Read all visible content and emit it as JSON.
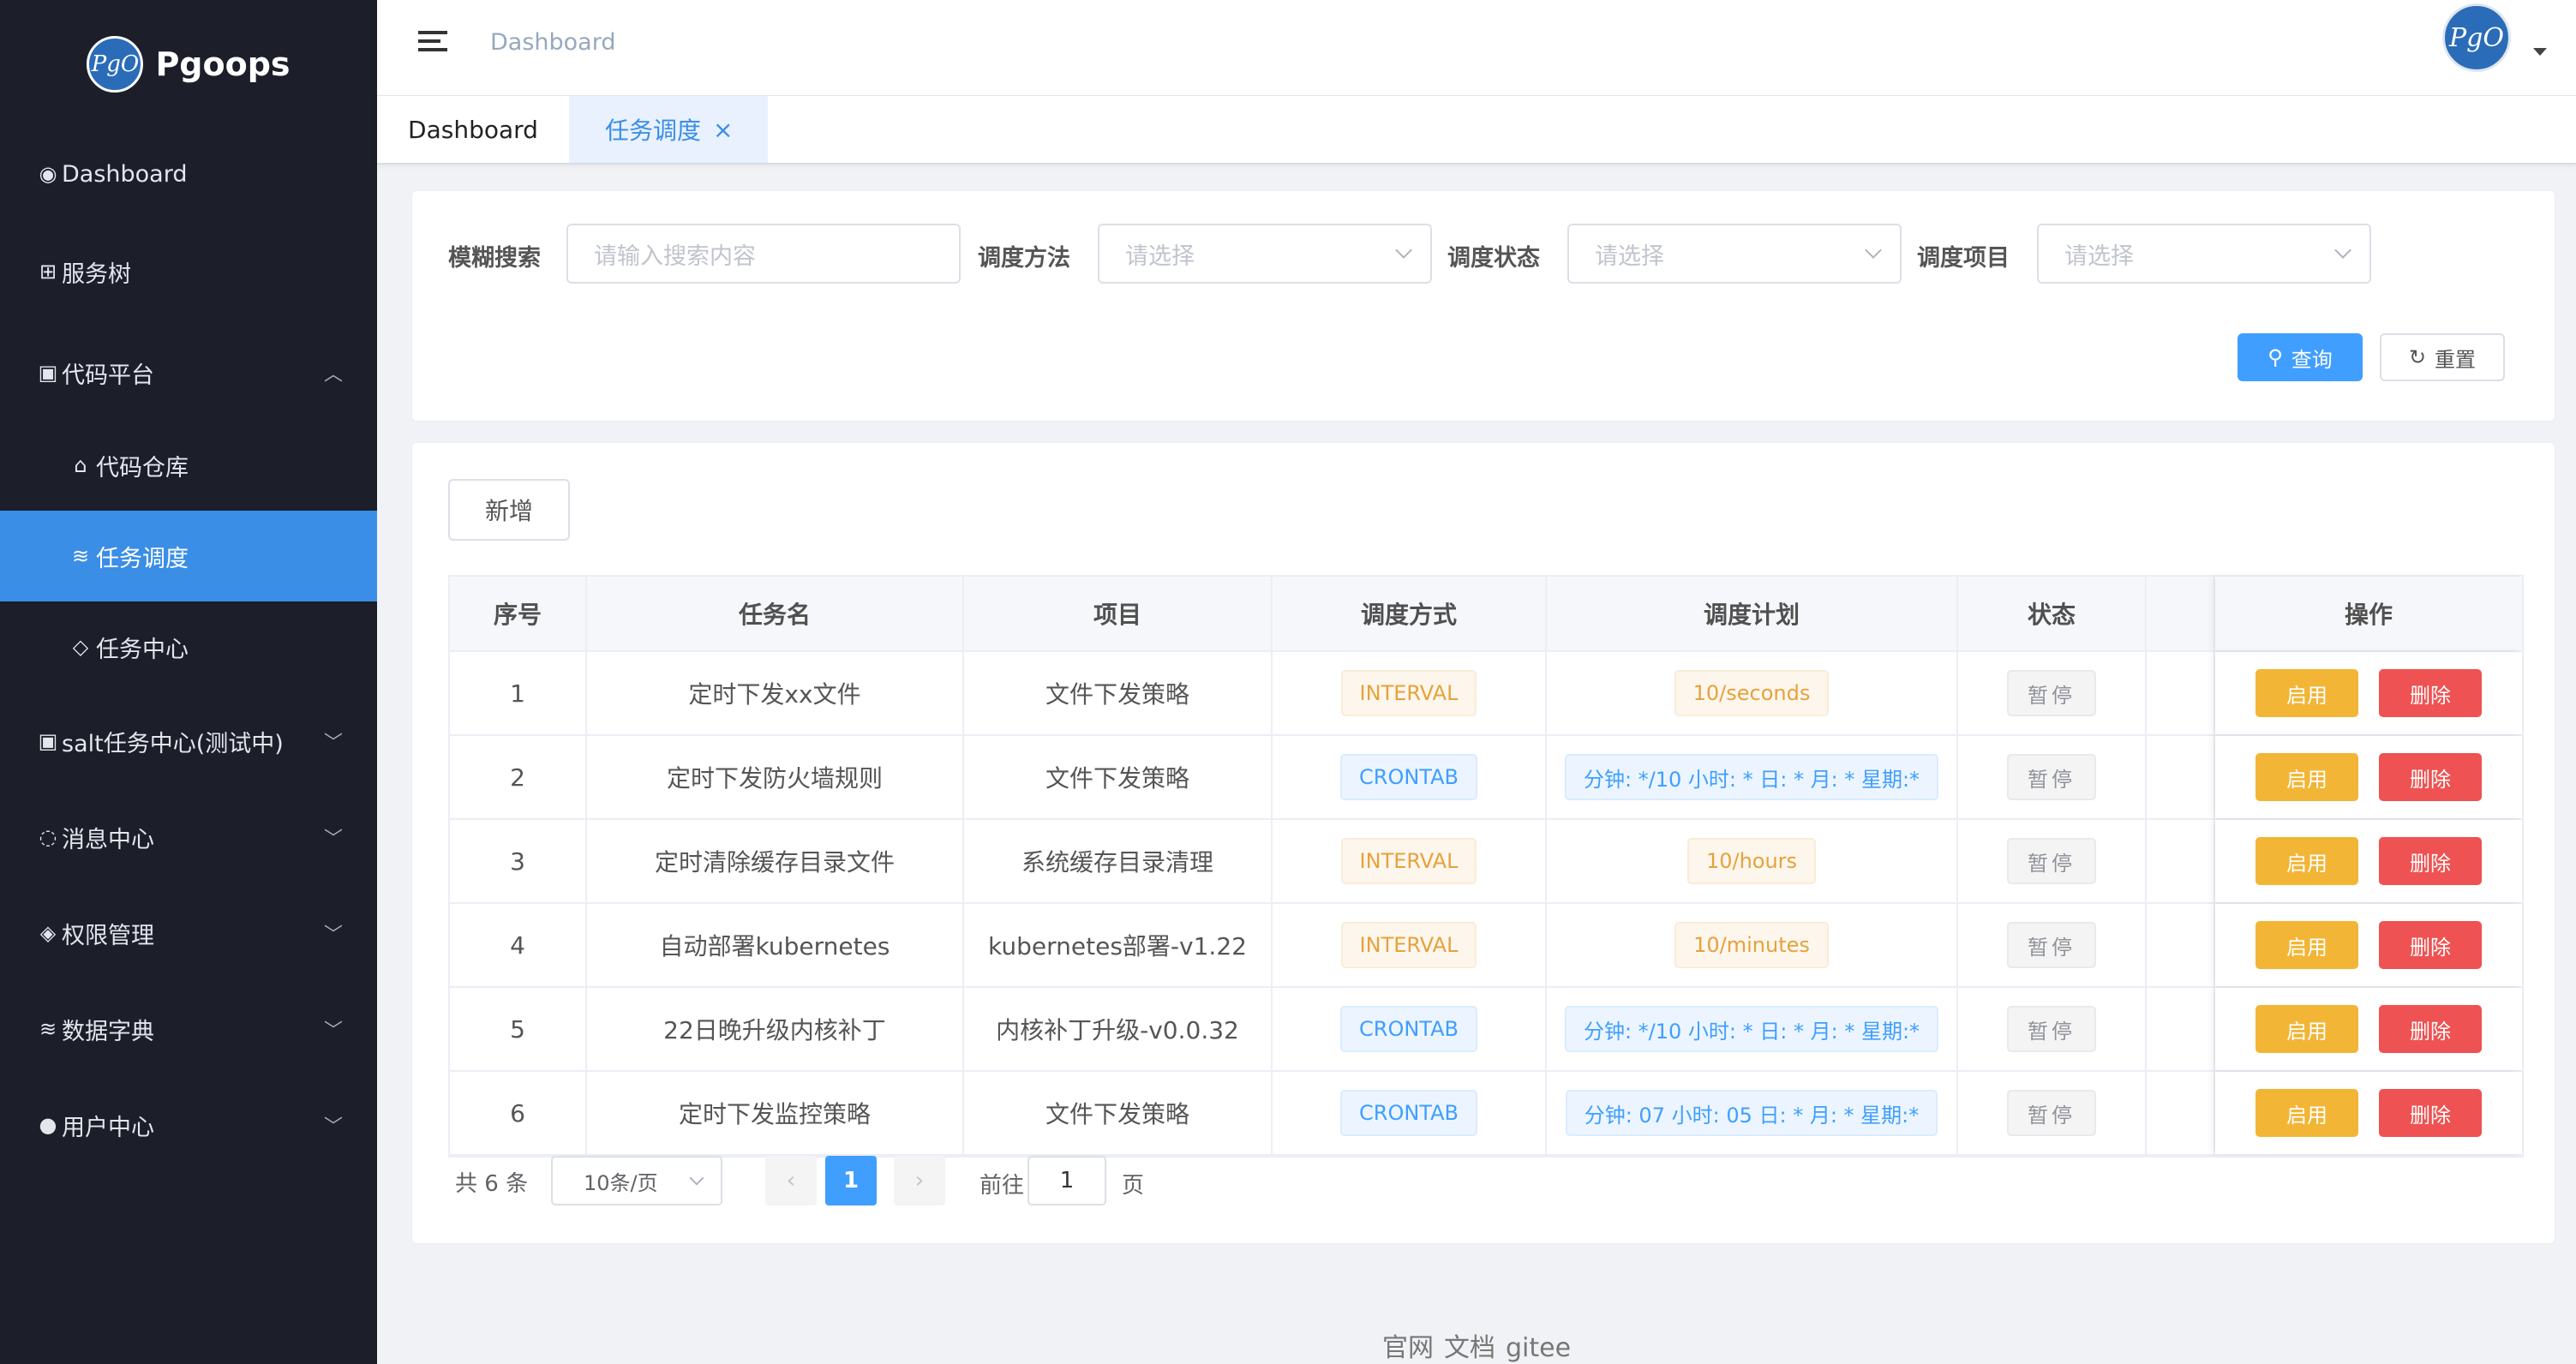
{
  "app": {
    "name": "Pgoops",
    "logo_mark": "PgO"
  },
  "sidebar": {
    "items": [
      {
        "label": "Dashboard",
        "icon": "dashboard-icon",
        "glyph": "◉"
      },
      {
        "label": "服务树",
        "icon": "tree-icon",
        "glyph": "⊞"
      },
      {
        "label": "代码平台",
        "icon": "code-icon",
        "glyph": "▣",
        "arrow": "︿"
      },
      {
        "label": "代码仓库",
        "icon": "repo-icon",
        "glyph": "⌂"
      },
      {
        "label": "任务调度",
        "icon": "schedule-icon",
        "glyph": "≋"
      },
      {
        "label": "任务中心",
        "icon": "shield-icon",
        "glyph": "◇"
      },
      {
        "label": "salt任务中心(测试中)",
        "icon": "salt-icon",
        "glyph": "▣",
        "arrow": "﹀"
      },
      {
        "label": "消息中心",
        "icon": "message-icon",
        "glyph": "◌",
        "arrow": "﹀"
      },
      {
        "label": "权限管理",
        "icon": "permission-icon",
        "glyph": "◈",
        "arrow": "﹀"
      },
      {
        "label": "数据字典",
        "icon": "dictionary-icon",
        "glyph": "≋",
        "arrow": "﹀"
      },
      {
        "label": "用户中心",
        "icon": "user-icon",
        "glyph": "●",
        "arrow": "﹀"
      }
    ]
  },
  "header": {
    "breadcrumb": "Dashboard",
    "avatar": "PgO"
  },
  "tabs": [
    {
      "label": "Dashboard"
    },
    {
      "label": "任务调度",
      "close": "×"
    }
  ],
  "search": {
    "fuzzy_label": "模糊搜索",
    "fuzzy_placeholder": "请输入搜索内容",
    "method_label": "调度方法",
    "method_placeholder": "请选择",
    "status_label": "调度状态",
    "status_placeholder": "请选择",
    "project_label": "调度项目",
    "project_placeholder": "请选择",
    "query_label": "查询",
    "reset_label": "重置"
  },
  "table": {
    "add_label": "新增",
    "columns": [
      "序号",
      "任务名",
      "项目",
      "调度方式",
      "调度计划",
      "状态",
      "",
      "操作"
    ],
    "rows": [
      {
        "id": "1",
        "name": "定时下发xx文件",
        "project": "文件下发策略",
        "method": "INTERVAL",
        "plan": "10/seconds",
        "status": "暂停",
        "enable": "启用",
        "delete": "删除"
      },
      {
        "id": "2",
        "name": "定时下发防火墙规则",
        "project": "文件下发策略",
        "method": "CRONTAB",
        "plan": "分钟: */10 小时: * 日: * 月: * 星期:*",
        "status": "暂停",
        "enable": "启用",
        "delete": "删除"
      },
      {
        "id": "3",
        "name": "定时清除缓存目录文件",
        "project": "系统缓存目录清理",
        "method": "INTERVAL",
        "plan": "10/hours",
        "status": "暂停",
        "enable": "启用",
        "delete": "删除"
      },
      {
        "id": "4",
        "name": "自动部署kubernetes",
        "project": "kubernetes部署-v1.22",
        "method": "INTERVAL",
        "plan": "10/minutes",
        "status": "暂停",
        "enable": "启用",
        "delete": "删除"
      },
      {
        "id": "5",
        "name": "22日晚升级内核补丁",
        "project": "内核补丁升级-v0.0.32",
        "method": "CRONTAB",
        "plan": "分钟: */10 小时: * 日: * 月: * 星期:*",
        "status": "暂停",
        "enable": "启用",
        "delete": "删除"
      },
      {
        "id": "6",
        "name": "定时下发监控策略",
        "project": "文件下发策略",
        "method": "CRONTAB",
        "plan": "分钟: 07 小时: 05 日: * 月: * 星期:*",
        "status": "暂停",
        "enable": "启用",
        "delete": "删除"
      }
    ]
  },
  "pagination": {
    "total": "共 6 条",
    "page_size": "10条/页",
    "prev": "‹",
    "current": "1",
    "next": "›",
    "goto_label": "前往",
    "goto_value": "1",
    "page_suffix": "页"
  },
  "footer": {
    "links": [
      "官网",
      "文档",
      "gitee"
    ]
  },
  "colors": {
    "sidebar_bg": "#1c1e2a",
    "accent": "#409eff",
    "active_menu": "#3a8ee6",
    "warning": "#f2b535",
    "danger": "#ee5252"
  }
}
